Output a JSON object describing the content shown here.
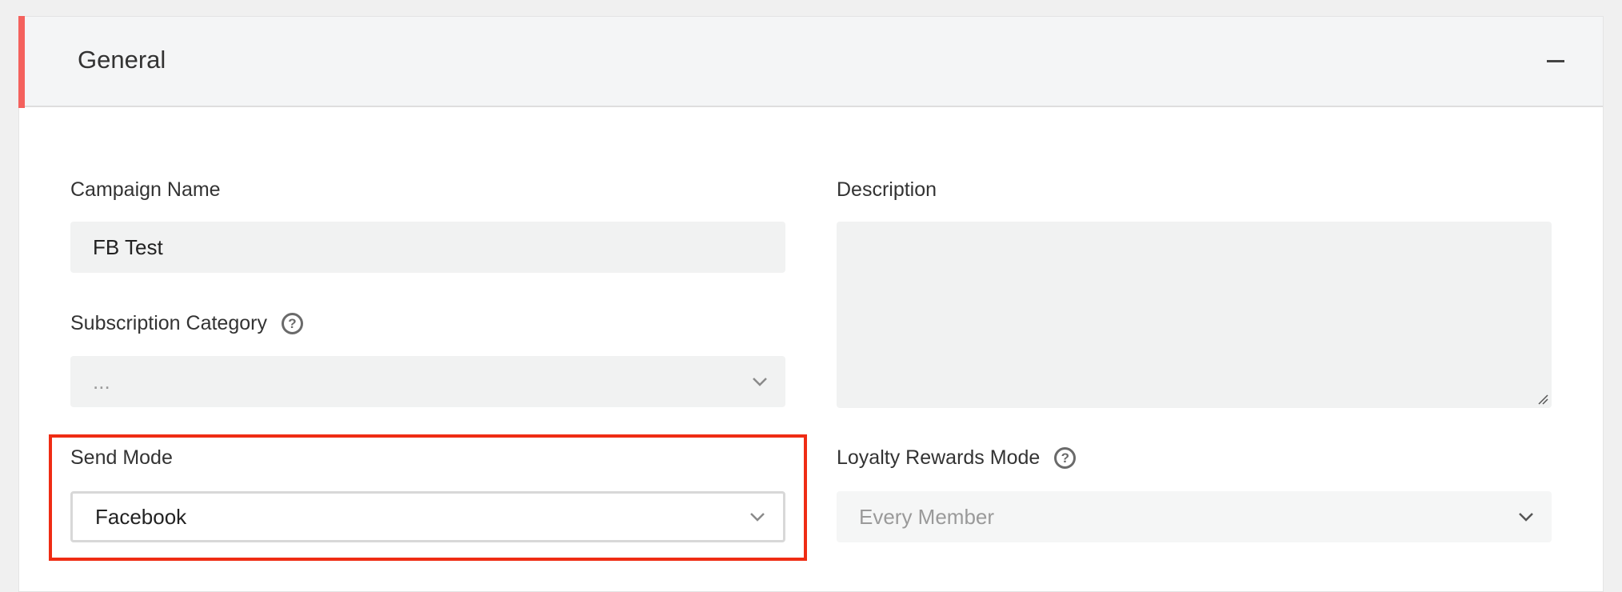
{
  "panel": {
    "title": "General",
    "collapse_icon": "minus-icon"
  },
  "fields": {
    "campaign_name": {
      "label": "Campaign Name",
      "value": "FB Test"
    },
    "description": {
      "label": "Description",
      "value": ""
    },
    "subscription_category": {
      "label": "Subscription Category",
      "value": "...",
      "help_icon": "question-circle-icon"
    },
    "send_mode": {
      "label": "Send Mode",
      "value": "Facebook"
    },
    "loyalty_rewards_mode": {
      "label": "Loyalty Rewards Mode",
      "value": "Every Member",
      "help_icon": "question-circle-icon"
    }
  },
  "help_glyph": "?",
  "colors": {
    "accent": "#f4615d",
    "highlight": "#ef2c14",
    "input_bg": "#f1f2f2",
    "header_bg": "#f4f5f6"
  }
}
